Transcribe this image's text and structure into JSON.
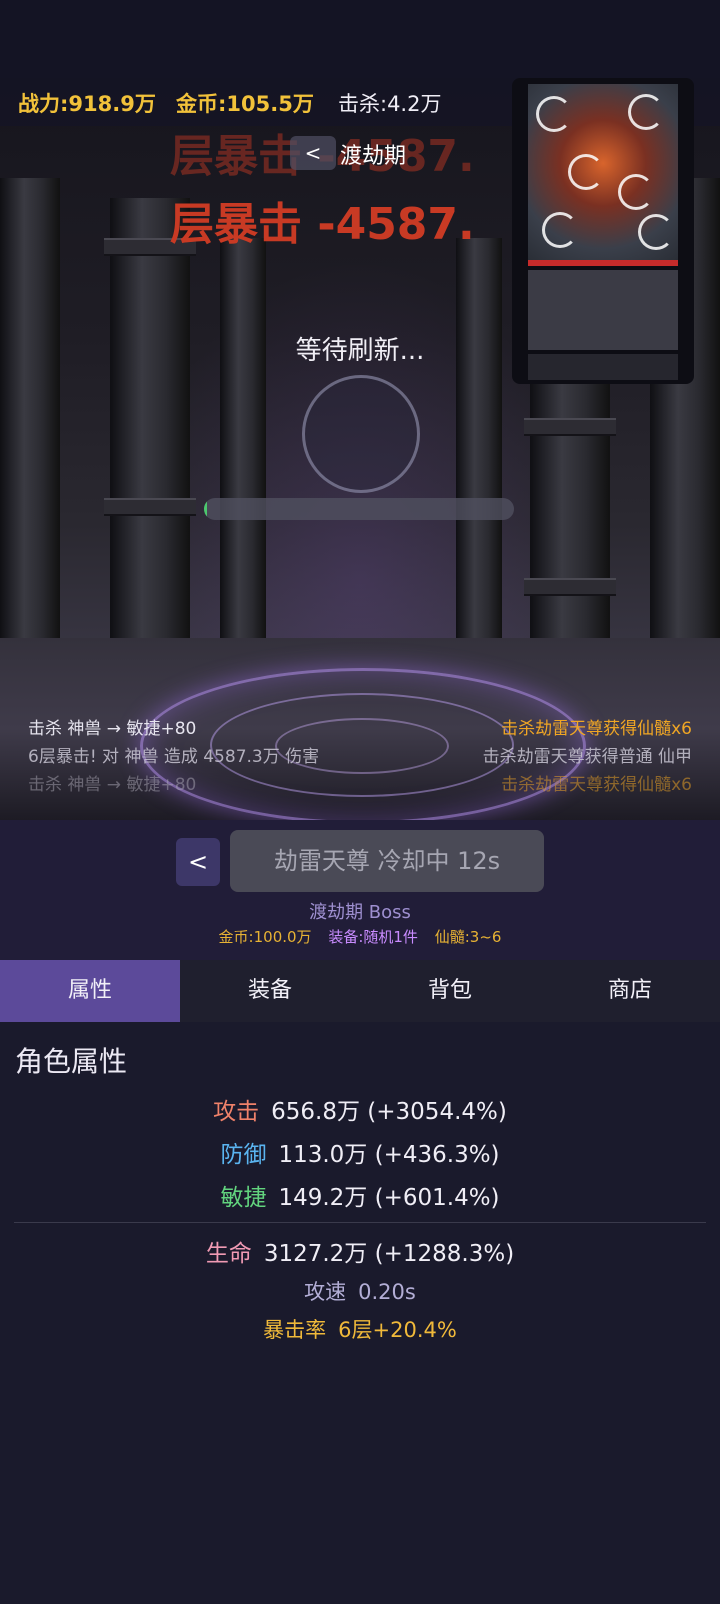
{
  "top_stats": {
    "power": "战力:918.9万",
    "gold": "金币:105.5万",
    "kills": "击杀:4.2万"
  },
  "scene": {
    "back_label": "<",
    "title": "渡劫期",
    "overlay_gold": "金币:105.5万",
    "float_crit": "层暴击 -4587.",
    "float_crit_ghost": "层暴击 -4587.",
    "wait_text": "等待刷新...",
    "progress": 0.01
  },
  "logs": {
    "left": [
      "击杀 神兽 → 敏捷+80",
      "6层暴击! 对 神兽 造成 4587.3万 伤害",
      "击杀 神兽 → 敏捷+80"
    ],
    "right": [
      "击杀劫雷天尊获得仙髓x6",
      "击杀劫雷天尊获得普通 仙甲",
      "击杀劫雷天尊获得仙髓x6"
    ]
  },
  "boss": {
    "back_label": "<",
    "cooldown_label": "劫雷天尊 冷却中 12s",
    "subtitle": "渡劫期 Boss",
    "reward_gold": "金币:100.0万",
    "reward_equip": "装备:随机1件",
    "reward_xs": "仙髓:3~6"
  },
  "tabs": [
    {
      "label": "属性",
      "active": true
    },
    {
      "label": "装备",
      "active": false
    },
    {
      "label": "背包",
      "active": false
    },
    {
      "label": "商店",
      "active": false
    }
  ],
  "attributes": {
    "title": "角色属性",
    "attack": {
      "label": "攻击",
      "value": "656.8万 (+3054.4%)",
      "color": "#f0826a"
    },
    "defense": {
      "label": "防御",
      "value": "113.0万 (+436.3%)",
      "color": "#5ab4f0"
    },
    "agility": {
      "label": "敏捷",
      "value": "149.2万 (+601.4%)",
      "color": "#62d47e"
    },
    "hp": {
      "label": "生命",
      "value": "3127.2万 (+1288.3%)",
      "color": "#f09ab4"
    },
    "speed": {
      "label": "攻速",
      "value": "0.20s",
      "color": "#b3aed6"
    },
    "crit": {
      "label": "暴击率",
      "value": "6层+20.4%",
      "color": "#f0b93a"
    }
  }
}
